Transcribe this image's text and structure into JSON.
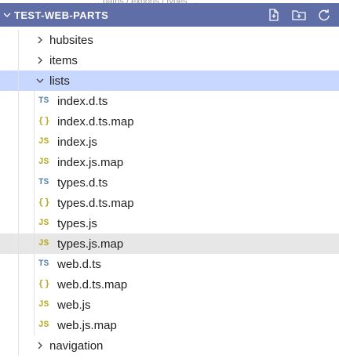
{
  "top_strip": "…paths / exports / types …",
  "header": {
    "title": "TEST-WEB-PARTS"
  },
  "icons": {
    "header_chevron": "chevron-down-icon",
    "new_file": "new-file-icon",
    "new_folder": "new-folder-icon",
    "refresh": "refresh-icon"
  },
  "tree": {
    "folders_before": [
      {
        "label": "hubsites"
      },
      {
        "label": "items"
      }
    ],
    "open_folder": {
      "label": "lists"
    },
    "files": [
      {
        "label": "index.d.ts",
        "icon": "TS"
      },
      {
        "label": "index.d.ts.map",
        "icon": "{}"
      },
      {
        "label": "index.js",
        "icon": "JS"
      },
      {
        "label": "index.js.map",
        "icon": "JS"
      },
      {
        "label": "types.d.ts",
        "icon": "TS"
      },
      {
        "label": "types.d.ts.map",
        "icon": "{}"
      },
      {
        "label": "types.js",
        "icon": "JS"
      },
      {
        "label": "types.js.map",
        "icon": "JS"
      },
      {
        "label": "web.d.ts",
        "icon": "TS"
      },
      {
        "label": "web.d.ts.map",
        "icon": "{}"
      },
      {
        "label": "web.js",
        "icon": "JS"
      },
      {
        "label": "web.js.map",
        "icon": "JS"
      }
    ],
    "folders_after": [
      {
        "label": "navigation"
      }
    ]
  },
  "colors": {
    "header_bg": "#5f6ea6",
    "selected_bg": "#c7d7fd",
    "hover_bg": "#e7e7e7",
    "ts_icon": "#5a86ad",
    "js_icon": "#b5a91f"
  }
}
